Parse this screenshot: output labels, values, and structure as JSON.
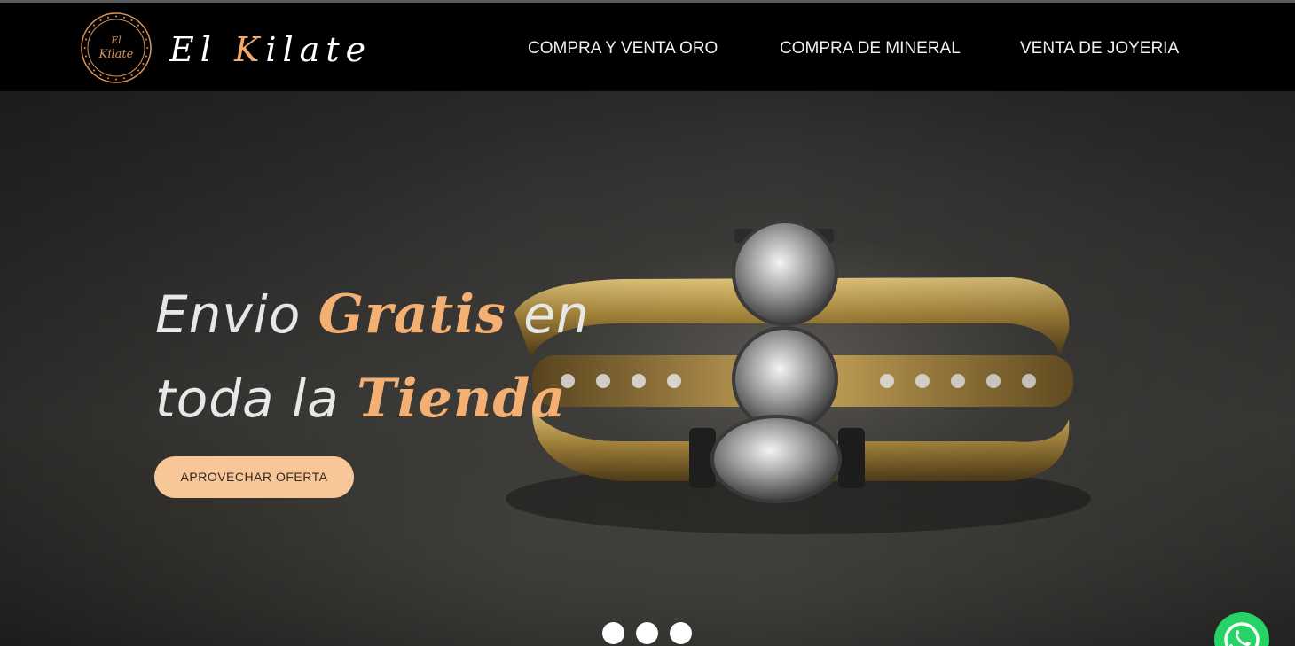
{
  "brand": {
    "badge_line1": "El",
    "badge_line2": "Kilate",
    "name_part1": "El ",
    "name_accent": "K",
    "name_part2": "ilate",
    "accent_color": "#f2a86a"
  },
  "nav": {
    "items": [
      {
        "label": "COMPRA Y VENTA ORO"
      },
      {
        "label": "COMPRA DE MINERAL"
      },
      {
        "label": "VENTA DE JOYERIA"
      }
    ]
  },
  "hero": {
    "headline_w1": "Envio ",
    "headline_w2": "Gratis",
    "headline_w3": " en",
    "headline_w4": "toda la ",
    "headline_w5": "Tienda",
    "cta_label": "APROVECHAR OFERTA",
    "slides": 3,
    "accent_color": "#f4b073",
    "button_color": "#f7c79a"
  },
  "floating": {
    "whatsapp_icon": "whatsapp-icon",
    "whatsapp_color": "#25d366"
  }
}
